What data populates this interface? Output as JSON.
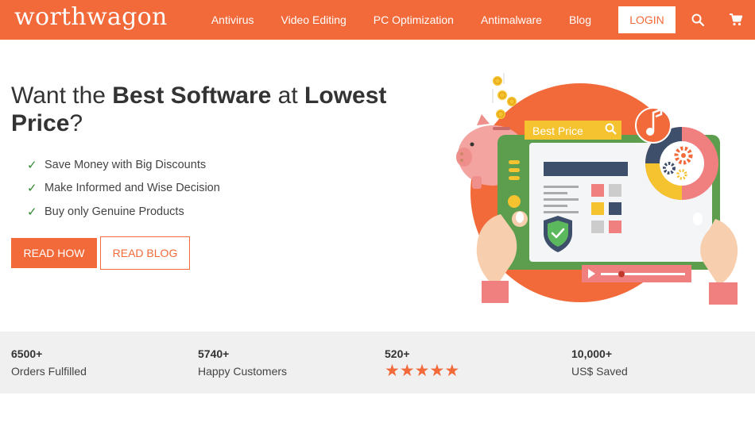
{
  "brand": {
    "logo": "worthwagon"
  },
  "nav": {
    "items": [
      {
        "label": "Antivirus"
      },
      {
        "label": "Video Editing"
      },
      {
        "label": "PC Optimization"
      },
      {
        "label": "Antimalware"
      },
      {
        "label": "Blog"
      }
    ],
    "login_label": "LOGIN",
    "search_icon": "search-icon",
    "cart_icon": "cart-icon"
  },
  "hero": {
    "title_part1": "Want the ",
    "title_bold1": "Best Software",
    "title_part2": " at ",
    "title_bold2": "Lowest Price",
    "title_part3": "?",
    "features": [
      {
        "icon": "check-icon",
        "text": "Save Money with Big Discounts"
      },
      {
        "icon": "check-icon",
        "text": "Make Informed and Wise Decision"
      },
      {
        "icon": "check-icon",
        "text": "Buy only Genuine Products"
      }
    ],
    "primary_button": "READ HOW",
    "secondary_button": "READ BLOG",
    "illustration": {
      "search_label": "Best Price"
    }
  },
  "stats": [
    {
      "value": "6500+",
      "label": "Orders Fulfilled"
    },
    {
      "value": "5740+",
      "label": "Happy Customers"
    },
    {
      "value": "520+",
      "rating": 5,
      "max_rating": 5
    },
    {
      "value": "10,000+",
      "label": "US$ Saved"
    }
  ],
  "colors": {
    "accent": "#f26a3a",
    "check": "#2e8b2e",
    "stats_bg": "#f0f0f0"
  }
}
